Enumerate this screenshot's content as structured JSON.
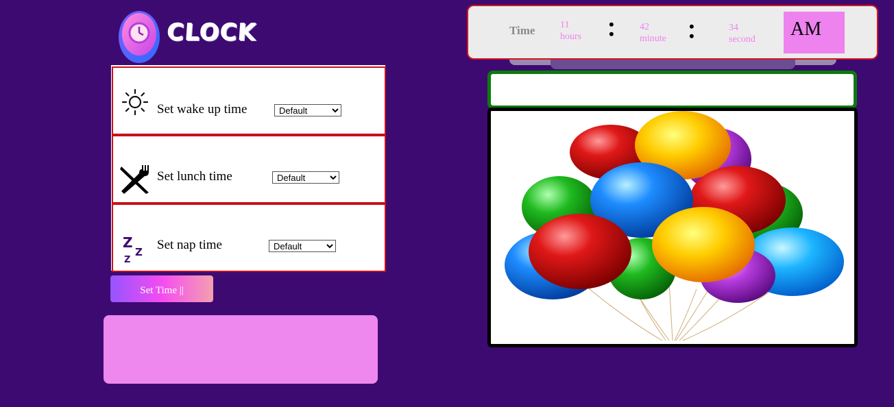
{
  "logo": {
    "text": "CLOCK"
  },
  "alarms": [
    {
      "label": "Set wake up time",
      "icon": "sun-icon",
      "select_value": "Default"
    },
    {
      "label": "Set lunch time",
      "icon": "fork-knife-icon",
      "select_value": "Default"
    },
    {
      "label": "Set nap time",
      "icon": "sleep-zzz-icon",
      "select_value": "Default"
    }
  ],
  "set_button": {
    "label": "Set Time ||"
  },
  "message_box": {
    "text": ""
  },
  "clock": {
    "title": "Time",
    "hours_value": "11",
    "hours_unit": "hours",
    "minutes_value": "42",
    "minutes_unit": "minute",
    "seconds_value": "34",
    "seconds_unit": "second",
    "period": "AM"
  },
  "greeting": {
    "text": ""
  },
  "colors": {
    "background": "#3d0a72",
    "accent_pink": "#ee82ee",
    "border_red": "#c8111a",
    "border_green": "#0c7a0c"
  }
}
